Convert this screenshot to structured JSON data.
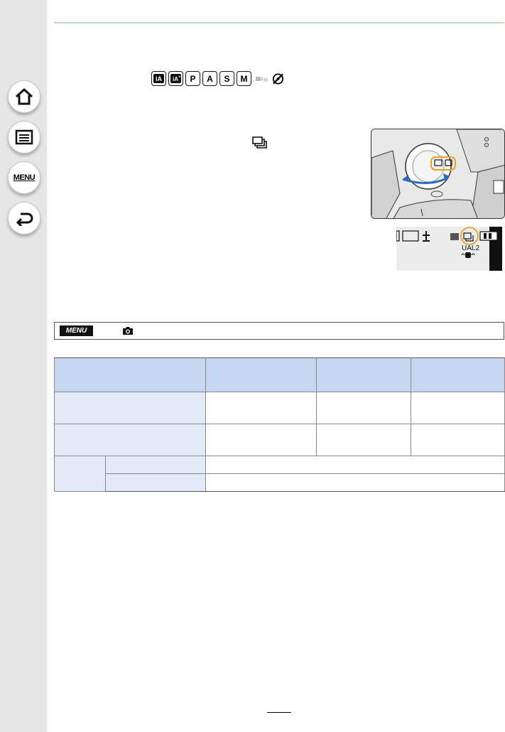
{
  "sidebar": {
    "items": [
      {
        "name": "home",
        "icon": "home-icon"
      },
      {
        "name": "contents",
        "icon": "list-icon"
      },
      {
        "name": "menu",
        "label": "MENU"
      },
      {
        "name": "back",
        "icon": "return-icon"
      }
    ]
  },
  "mode_icons": [
    "iA",
    "iA+",
    "P",
    "A",
    "S",
    "M",
    "M",
    "creative"
  ],
  "menu_bar": {
    "chip": "MENU"
  },
  "colors": {
    "accent_rule": "#c5cfe8",
    "header_cell": "#c7d6f1",
    "side_cell": "#e3eaf7",
    "dial_arrow": "#2a6ebf",
    "highlight": "#f0a020"
  },
  "lcd": {
    "text": "UAL2"
  }
}
